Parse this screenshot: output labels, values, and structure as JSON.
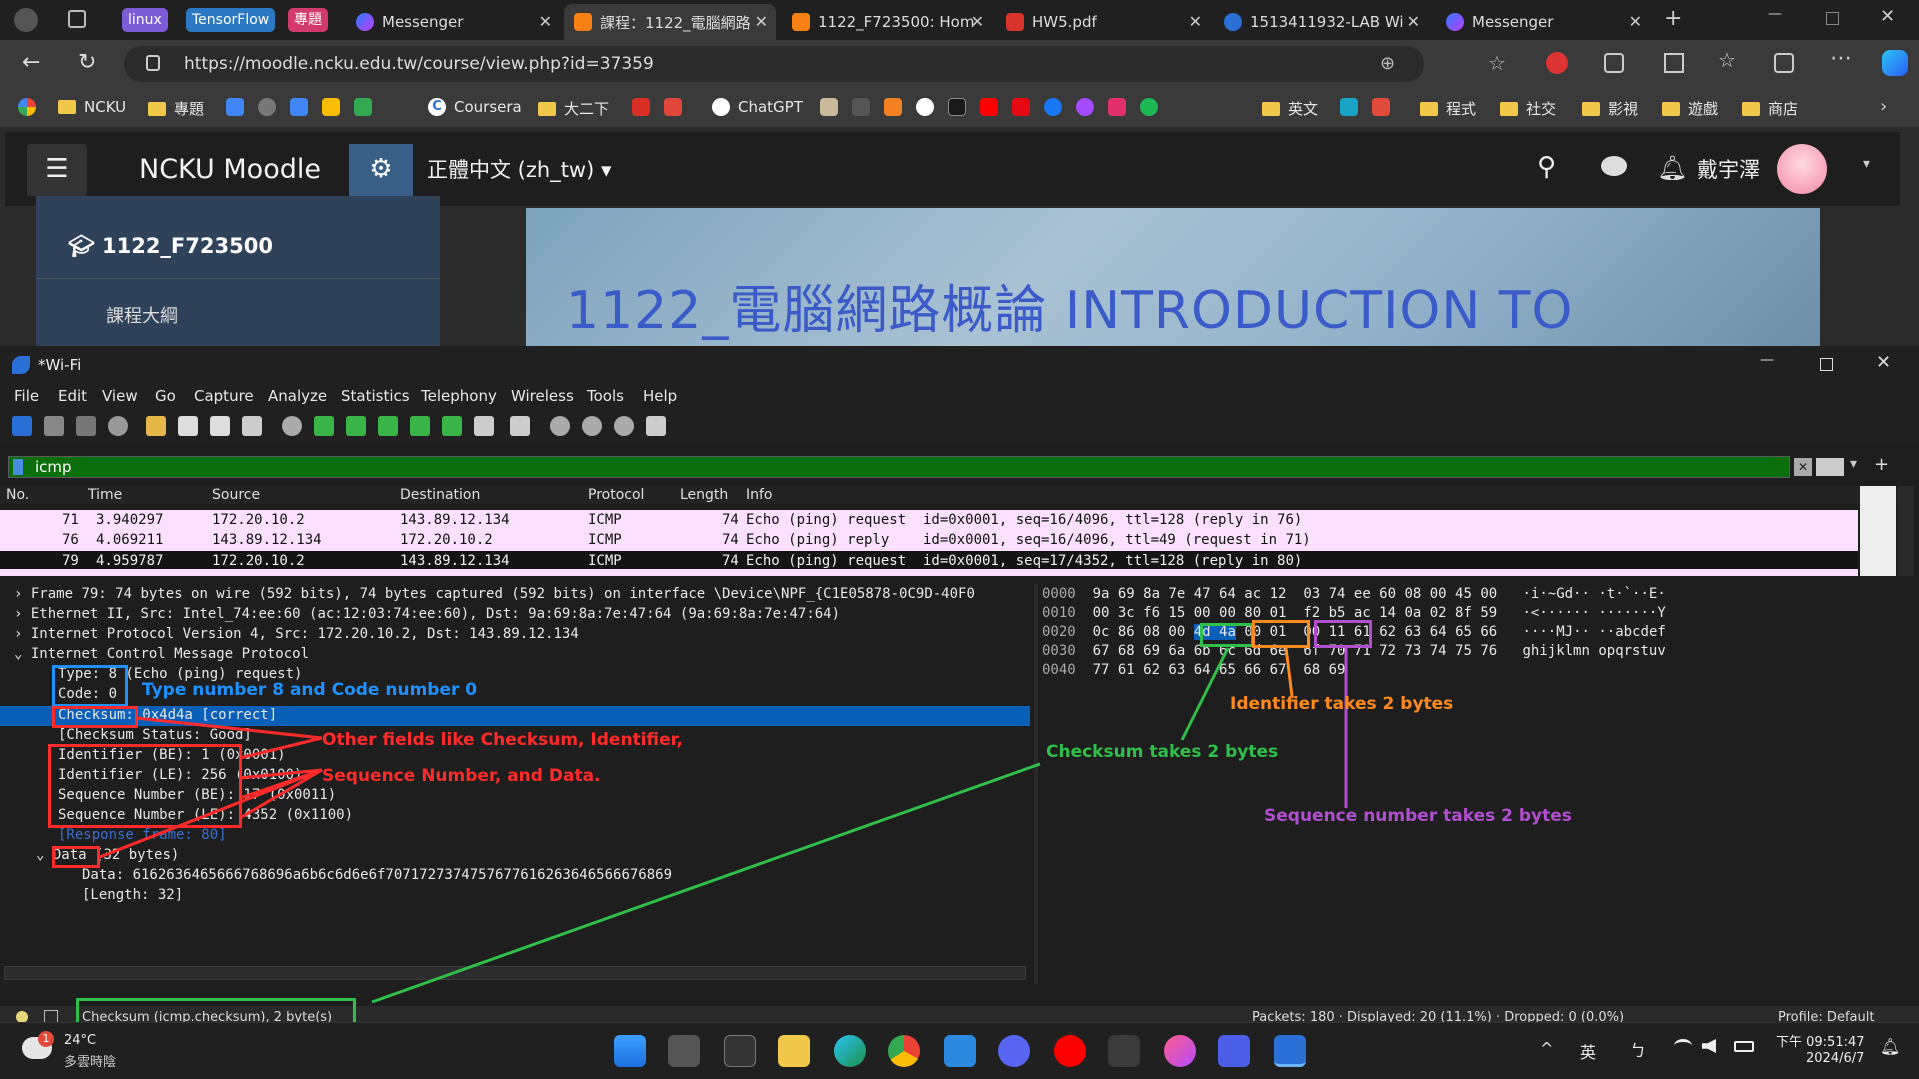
{
  "browser": {
    "tab_groups": [
      {
        "label": "linux",
        "color": "#7b5cd6"
      },
      {
        "label": "TensorFlow",
        "color": "#2b79c2"
      },
      {
        "label": "專題",
        "color": "#d23a6b"
      }
    ],
    "tabs": [
      {
        "label": "Messenger"
      },
      {
        "label": "課程：1122_電腦網路"
      },
      {
        "label": "1122_F723500: Hom"
      },
      {
        "label": "HW5.pdf"
      },
      {
        "label": "1513411932-LAB Wi"
      },
      {
        "label": "Messenger"
      }
    ],
    "url": "https://moodle.ncku.edu.tw/course/view.php?id=37359",
    "bookmarks": [
      "NCKU",
      "專題",
      "Coursera",
      "大二下",
      "ChatGPT",
      "英文",
      "程式",
      "社交",
      "影視",
      "遊戲",
      "商店"
    ]
  },
  "moodle": {
    "site_name": "NCKU Moodle",
    "language": "正體中文 (zh_tw)",
    "user_name": "戴宇澤",
    "course_code": "1122_F723500",
    "banner_title": "1122_電腦網路概論 INTRODUCTION TO",
    "sidebar_partial": "課程大綱"
  },
  "wireshark": {
    "window_title": "*Wi-Fi",
    "menu": [
      "File",
      "Edit",
      "View",
      "Go",
      "Capture",
      "Analyze",
      "Statistics",
      "Telephony",
      "Wireless",
      "Tools",
      "Help"
    ],
    "filter": "icmp",
    "columns": [
      "No.",
      "Time",
      "Source",
      "Destination",
      "Protocol",
      "Length",
      "Info"
    ],
    "packets": [
      {
        "no": "71",
        "time": "3.940297",
        "src": "172.20.10.2",
        "dst": "143.89.12.134",
        "proto": "ICMP",
        "len": "74",
        "info": "Echo (ping) request  id=0x0001, seq=16/4096, ttl=128 (reply in 76)"
      },
      {
        "no": "76",
        "time": "4.069211",
        "src": "143.89.12.134",
        "dst": "172.20.10.2",
        "proto": "ICMP",
        "len": "74",
        "info": "Echo (ping) reply    id=0x0001, seq=16/4096, ttl=49 (request in 71)"
      },
      {
        "no": "79",
        "time": "4.959787",
        "src": "172.20.10.2",
        "dst": "143.89.12.134",
        "proto": "ICMP",
        "len": "74",
        "info": "Echo (ping) request  id=0x0001, seq=17/4352, ttl=128 (reply in 80)"
      }
    ],
    "details": [
      "Frame 79: 74 bytes on wire (592 bits), 74 bytes captured (592 bits) on interface \\Device\\NPF_{C1E05878-0C9D-40F0",
      "Ethernet II, Src: Intel_74:ee:60 (ac:12:03:74:ee:60), Dst: 9a:69:8a:7e:47:64 (9a:69:8a:7e:47:64)",
      "Internet Protocol Version 4, Src: 172.20.10.2, Dst: 143.89.12.134",
      "Internet Control Message Protocol",
      "Type: 8 (Echo (ping) request)",
      "Code: 0",
      "Checksum: 0x4d4a [correct]",
      "[Checksum Status: Good]",
      "Identifier (BE): 1 (0x0001)",
      "Identifier (LE): 256 (0x0100)",
      "Sequence Number (BE): 17 (0x0011)",
      "Sequence Number (LE): 4352 (0x1100)",
      "[Response frame: 80]",
      "Data (32 bytes)",
      "Data: 6162636465666768696a6b6c6d6e6f7071727374757677616263646566676869",
      "[Length: 32]"
    ],
    "hex": [
      {
        "off": "0000",
        "a": "9a 69 8a 7e 47 64 ac 12",
        "b": "03 74 ee 60 08 00 45 00",
        "ascii": "·i·~Gd·· ·t·`··E·"
      },
      {
        "off": "0010",
        "a": "00 3c f6 15 00 00 80 01",
        "b": "f2 b5 ac 14 0a 02 8f 59",
        "ascii": "·<······ ·······Y"
      },
      {
        "off": "0020",
        "a": "0c 86 08 00 ",
        "hl1": "4d 4a",
        "sp": " ",
        "hl2": "00 01",
        "sp2": "  ",
        "hl3": "00 11",
        "b": " 61 62 63 64 65 66",
        "ascii": "····MJ·· ··abcdef"
      },
      {
        "off": "0030",
        "a": "67 68 69 6a 6b 6c 6d 6e",
        "b": "6f 70 71 72 73 74 75 76",
        "ascii": "ghijklmn opqrstuv"
      },
      {
        "off": "0040",
        "a": "77 61 62 63 64 65 66 67",
        "b": "68 69",
        "ascii": "wabcdefg hi"
      }
    ],
    "status_field": "Checksum (icmp.checksum), 2 byte(s)",
    "status_packets": "Packets: 180 · Displayed: 20 (11.1%) · Dropped: 0 (0.0%)",
    "status_profile": "Profile: Default"
  },
  "annotations": {
    "type_code": "Type number 8 and Code number 0",
    "other_fields_1": "Other fields like Checksum, Identifier,",
    "other_fields_2": "Sequence Number, and Data.",
    "identifier": "Identifier takes 2 bytes",
    "checksum": "Checksum takes 2 bytes",
    "sequence": "Sequence number takes 2 bytes",
    "colors": {
      "blue": "#1e90ff",
      "red": "#ff2a2a",
      "orange": "#ff8a1e",
      "green": "#2fbf4a",
      "purple": "#b04fd0"
    }
  },
  "taskbar": {
    "temp": "24°C",
    "weather": "多雲時陰",
    "ime": "英",
    "time": "下午 09:51:47",
    "date": "2024/6/7"
  }
}
